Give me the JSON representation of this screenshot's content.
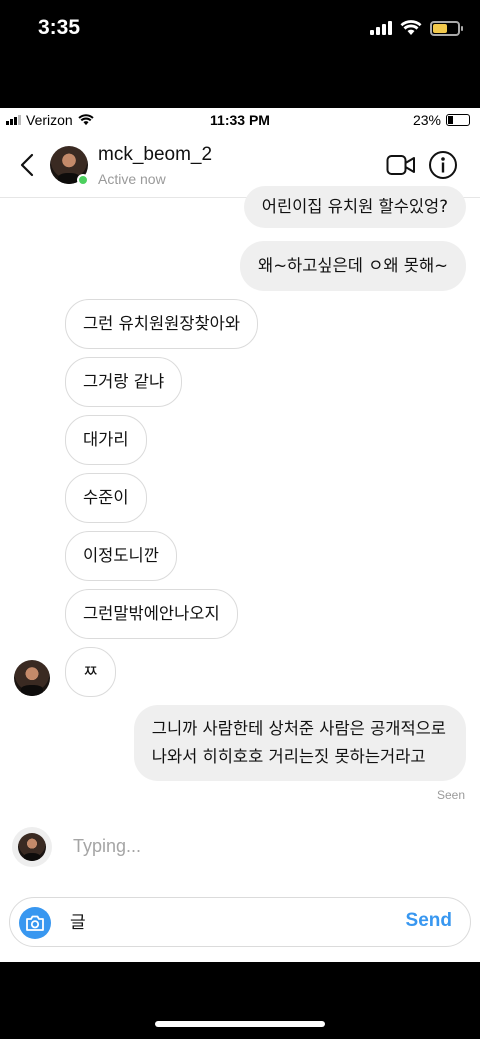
{
  "outer_status": {
    "time": "3:35",
    "battery_color": "#f2c94c"
  },
  "inner_status": {
    "carrier": "Verizon",
    "time": "11:33 PM",
    "battery": "23%"
  },
  "header": {
    "back_icon": "chevron-left-icon",
    "username": "mck_beom_2",
    "status": "Active now",
    "video_icon": "video-camera-icon",
    "info_icon": "info-icon"
  },
  "messages": [
    {
      "side": "outgoing",
      "text": "어린이집 유치원 할수있엉?"
    },
    {
      "side": "outgoing",
      "text": "왜~하고싶은데 ㅇ왜 못해~"
    },
    {
      "side": "incoming",
      "text": "그런 유치원원장찾아와"
    },
    {
      "side": "incoming",
      "text": "그거랑 같냐"
    },
    {
      "side": "incoming",
      "text": "대가리"
    },
    {
      "side": "incoming",
      "text": "수준이"
    },
    {
      "side": "incoming",
      "text": "이정도니깐"
    },
    {
      "side": "incoming",
      "text": "그런말밖에안나오지"
    },
    {
      "side": "incoming",
      "text": "ㅉ"
    },
    {
      "side": "outgoing",
      "line1": "그니까 사람한테 상처준 사람은 공개적으로",
      "line2": "나와서 히히호호 거리는짓 못하는거라고"
    }
  ],
  "seen_label": "Seen",
  "typing_label": "Typing...",
  "composer": {
    "value": "글",
    "send_label": "Send",
    "camera_icon": "camera-icon"
  },
  "colors": {
    "accent": "#3897f0",
    "online": "#4cd05e",
    "outgoing_bubble": "#efefef"
  }
}
